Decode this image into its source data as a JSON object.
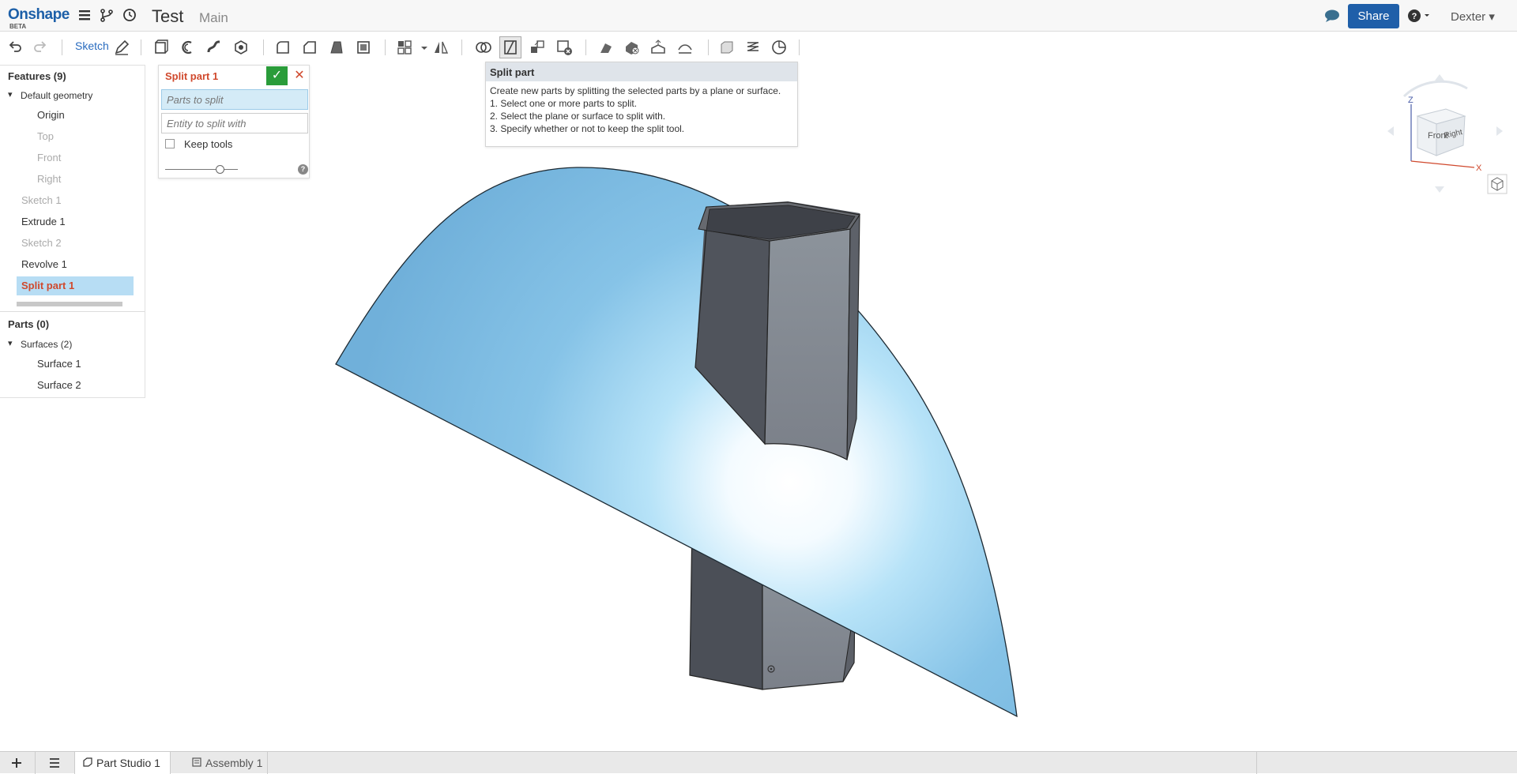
{
  "app": {
    "logo": "Onshape",
    "logo_badge": "BETA",
    "document_title": "Test",
    "workspace": "Main",
    "share_label": "Share",
    "user_name": "Dexter"
  },
  "toolbar": {
    "sketch_label": "Sketch"
  },
  "features": {
    "header": "Features (9)",
    "items": [
      {
        "label": "Default geometry",
        "state": "group"
      },
      {
        "label": "Origin",
        "state": "normal"
      },
      {
        "label": "Top",
        "state": "dim"
      },
      {
        "label": "Front",
        "state": "dim"
      },
      {
        "label": "Right",
        "state": "dim"
      },
      {
        "label": "Sketch 1",
        "state": "dim"
      },
      {
        "label": "Extrude 1",
        "state": "normal"
      },
      {
        "label": "Sketch 2",
        "state": "dim"
      },
      {
        "label": "Revolve 1",
        "state": "normal"
      },
      {
        "label": "Split part 1",
        "state": "selected"
      }
    ]
  },
  "parts": {
    "header": "Parts (0)",
    "group": "Surfaces (2)",
    "items": [
      "Surface 1",
      "Surface 2"
    ]
  },
  "dialog": {
    "title": "Split part 1",
    "ok_icon": "✓",
    "cancel_icon": "✕",
    "field_parts_placeholder": "Parts to split",
    "field_entity_placeholder": "Entity to split with",
    "keep_tools_label": "Keep tools",
    "keep_tools_checked": false,
    "help_icon": "?"
  },
  "tooltip": {
    "title": "Split part",
    "description": "Create new parts by splitting the selected parts by a plane or surface.",
    "steps": [
      "1.  Select one or more parts to split.",
      "2.  Select the plane or surface to split with.",
      "3.  Specify whether or not to keep the split tool."
    ]
  },
  "view_cube": {
    "front": "Front",
    "right": "Right",
    "axis_z": "Z",
    "axis_x": "X"
  },
  "bottom_tabs": [
    {
      "label": "Part Studio 1",
      "active": true
    },
    {
      "label": "Assembly 1",
      "active": false
    }
  ],
  "colors": {
    "accent": "#1f5fa9",
    "selected_text": "#d0492d",
    "surface": "#87c2e8",
    "part": "#5a5e66"
  }
}
